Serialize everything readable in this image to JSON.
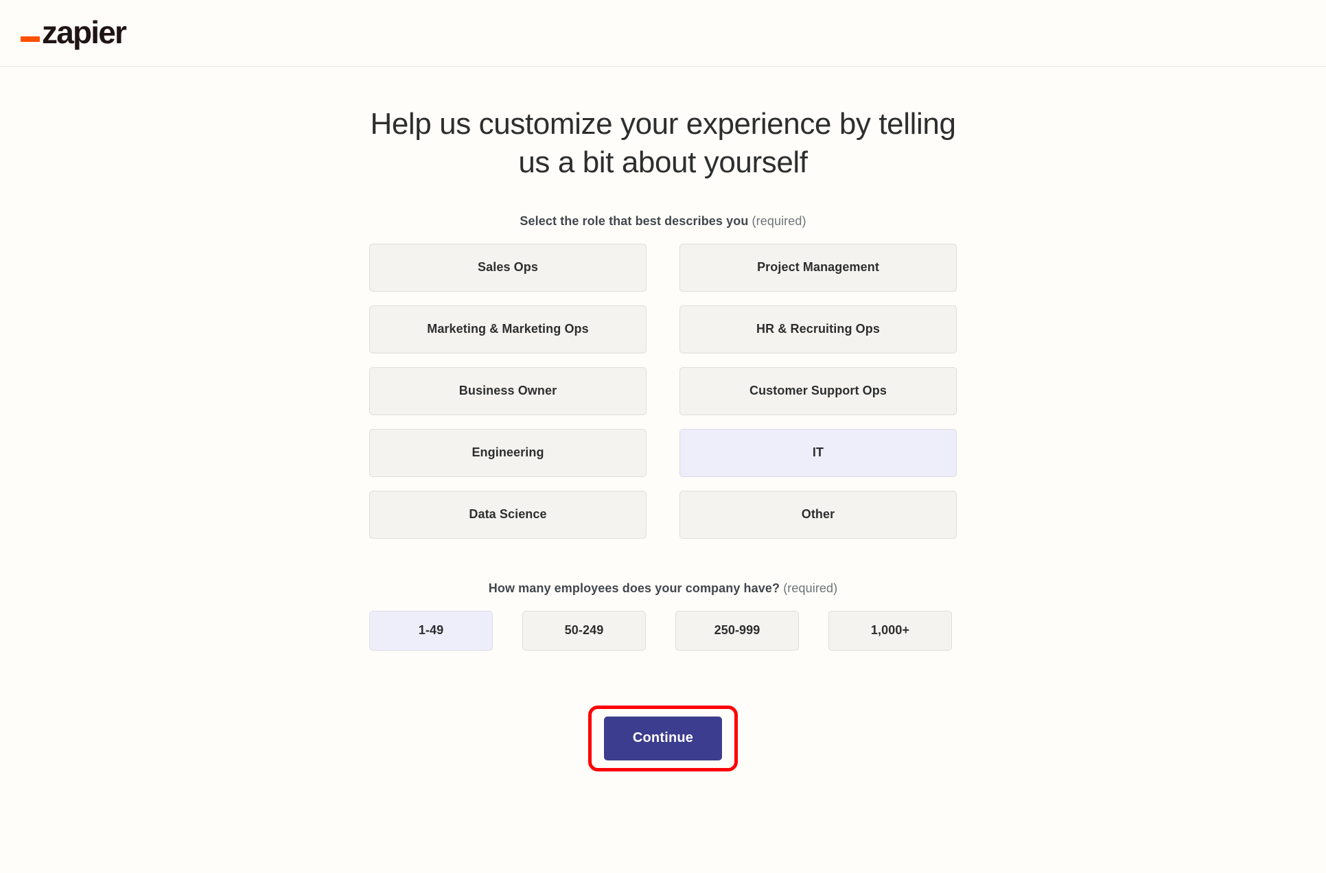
{
  "header": {
    "logo_text": "zapier",
    "logo_accent_color": "#FF4F00"
  },
  "main": {
    "page_title": "Help us customize your experience by telling us a bit about yourself",
    "role_section": {
      "label": "Select the role that best describes you",
      "required_note": "(required)",
      "options": [
        {
          "label": "Sales Ops",
          "selected": false
        },
        {
          "label": "Project Management",
          "selected": false
        },
        {
          "label": "Marketing & Marketing Ops",
          "selected": false
        },
        {
          "label": "HR & Recruiting Ops",
          "selected": false
        },
        {
          "label": "Business Owner",
          "selected": false
        },
        {
          "label": "Customer Support Ops",
          "selected": false
        },
        {
          "label": "Engineering",
          "selected": false
        },
        {
          "label": "IT",
          "selected": true
        },
        {
          "label": "Data Science",
          "selected": false
        },
        {
          "label": "Other",
          "selected": false
        }
      ]
    },
    "employees_section": {
      "label": "How many employees does your company have?",
      "required_note": "(required)",
      "options": [
        {
          "label": "1-49",
          "selected": true
        },
        {
          "label": "50-249",
          "selected": false
        },
        {
          "label": "250-999",
          "selected": false
        },
        {
          "label": "1,000+",
          "selected": false
        }
      ]
    },
    "continue_button": {
      "label": "Continue",
      "background_color": "#3D3D8F",
      "text_color": "#FFFFFF"
    },
    "annotation": {
      "color": "#FF0000",
      "target": "continue-button"
    }
  },
  "colors": {
    "page_background": "#FFFDF9",
    "choice_background": "#F4F3F0",
    "choice_selected_background": "#EEEDFA",
    "choice_border": "#DFDDD8",
    "text_primary": "#2D2E2E",
    "text_muted": "#6C7378"
  }
}
